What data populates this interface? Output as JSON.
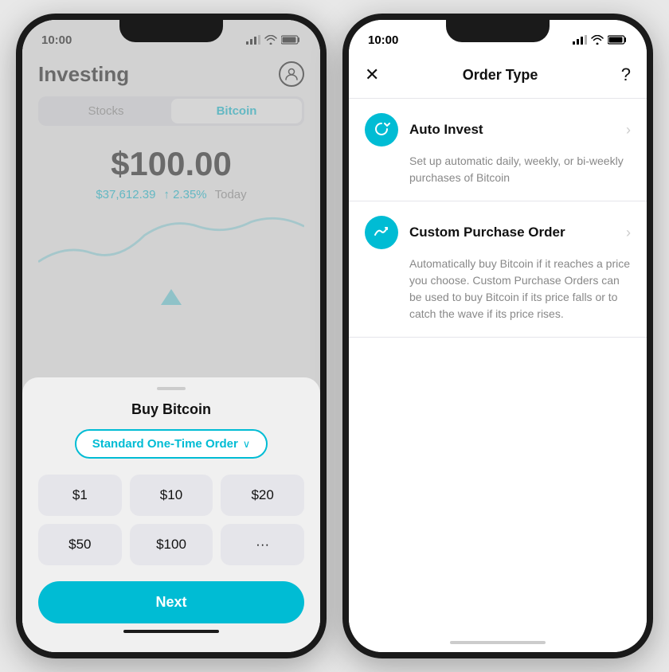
{
  "left_phone": {
    "status_bar": {
      "time": "10:00"
    },
    "header": {
      "title": "Investing"
    },
    "tabs": [
      {
        "label": "Stocks",
        "active": false
      },
      {
        "label": "Bitcoin",
        "active": true
      }
    ],
    "price": {
      "main": "$100.00",
      "btc": "$37,612.39",
      "change": "↑ 2.35%",
      "period": "Today"
    },
    "bottom_sheet": {
      "title": "Buy Bitcoin",
      "order_type": "Standard One-Time Order ∨",
      "amounts": [
        "$1",
        "$10",
        "$20",
        "$50",
        "$100",
        "···"
      ],
      "next_btn": "Next"
    }
  },
  "right_phone": {
    "status_bar": {
      "time": "10:00"
    },
    "modal": {
      "close_label": "✕",
      "title": "Order Type",
      "help_label": "?"
    },
    "options": [
      {
        "icon": "↻",
        "name": "Auto Invest",
        "description": "Set up automatic daily, weekly, or bi-weekly purchases of Bitcoin"
      },
      {
        "icon": "⤴",
        "name": "Custom Purchase Order",
        "description": "Automatically buy Bitcoin if it reaches a price you choose. Custom Purchase Orders can be used to buy Bitcoin if its price falls or to catch the wave if its price rises."
      }
    ]
  }
}
